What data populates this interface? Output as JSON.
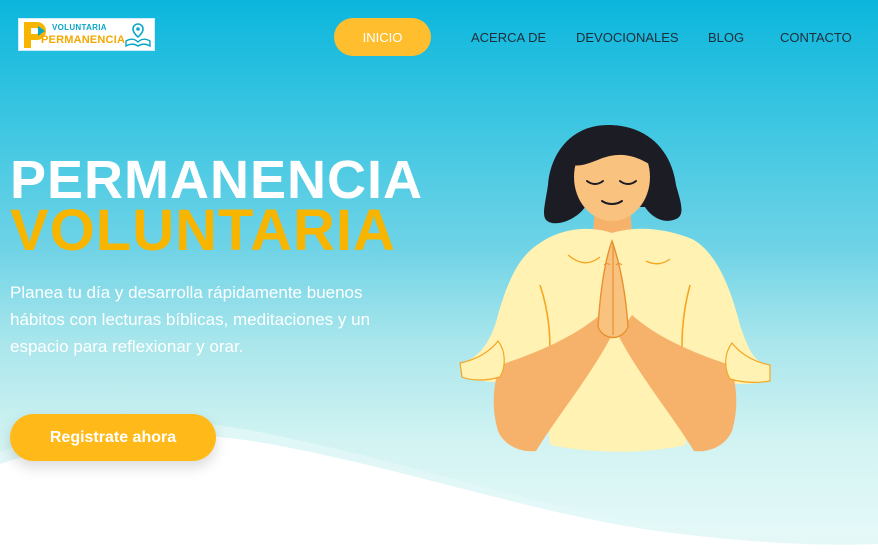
{
  "header": {
    "logo": {
      "line_top": "VOLUNTARIA",
      "line_bottom": "PERMANENCIA"
    },
    "nav": [
      {
        "label": "INICIO",
        "active": true
      },
      {
        "label": "ACERCA DE"
      },
      {
        "label": "DEVOCIONALES"
      },
      {
        "label": "BLOG"
      },
      {
        "label": "CONTACTO"
      }
    ]
  },
  "hero": {
    "title_line1": "PERMANENCIA",
    "title_line2": "VOLUNTARIA",
    "description": "Planea tu día y desarrolla rápidamente buenos hábitos con lecturas bíblicas, meditaciones y un espacio para reflexionar y orar.",
    "cta_label": "Registrate ahora",
    "illustration": "praying-woman-illustration"
  },
  "colors": {
    "accent": "#ffbe2e",
    "title_yellow": "#f7b500",
    "sky_top": "#0bb6dc",
    "sky_bottom": "#e8fafa"
  }
}
